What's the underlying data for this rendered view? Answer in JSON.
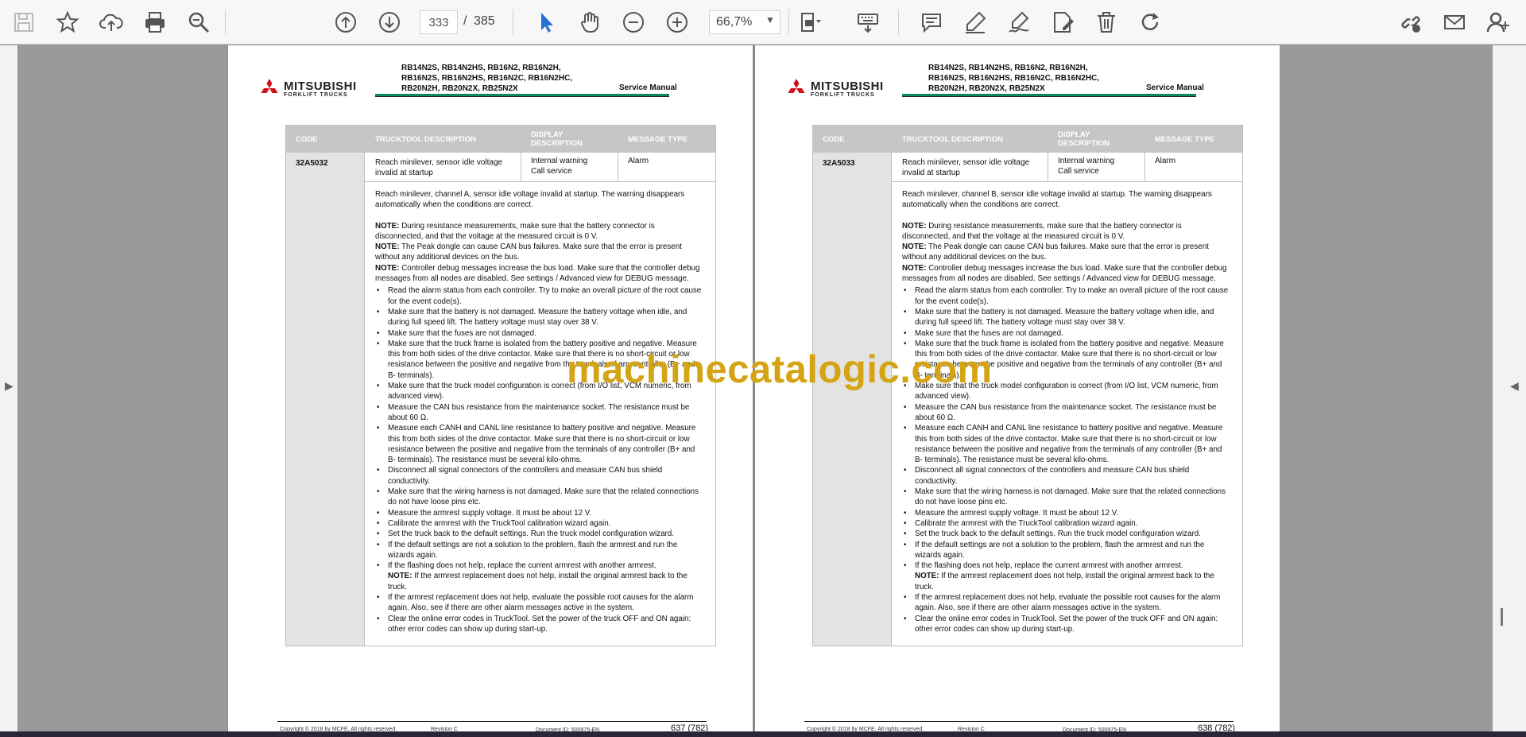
{
  "toolbar": {
    "page_current": "333",
    "page_separator": "/",
    "page_total": "385",
    "zoom": "66,7%",
    "icons": [
      "save-icon",
      "bookmark-star-icon",
      "upload-cloud-icon",
      "print-icon",
      "zoom-find-icon",
      "page-up-icon",
      "page-down-icon",
      "select-cursor-icon",
      "hand-tool-icon",
      "zoom-out-icon",
      "zoom-in-icon",
      "page-fit-icon",
      "keyboard-icon",
      "comment-icon",
      "highlight-pen-icon",
      "sign-icon",
      "edit-text-icon",
      "delete-icon",
      "redo-icon",
      "share-link-icon",
      "email-icon",
      "add-user-icon"
    ]
  },
  "colors": {
    "accent_green": "#0a8a5a",
    "header_gray": "#c6c6c6",
    "watermark": "#d4a414",
    "cursor_blue": "#2a6fd6"
  },
  "header": {
    "logo_text": "MITSUBISHI",
    "logo_subtext": "FORKLIFT TRUCKS",
    "models_line1": "RB14N2S, RB14N2HS, RB16N2, RB16N2H,",
    "models_line2": "RB16N2S, RB16N2HS, RB16N2C, RB16N2HC,",
    "models_line3": "RB20N2H, RB20N2X, RB25N2X",
    "service_manual": "Service Manual"
  },
  "table_header": {
    "code": "CODE",
    "trucktool": "TRUCKTOOL DESCRIPTION",
    "display1": "DISPLAY",
    "display2": "DESCRIPTION",
    "message": "MESSAGE TYPE"
  },
  "common": {
    "desc1": "Reach minilever, sensor idle voltage",
    "desc2": "invalid at startup",
    "disp1": "Internal warning",
    "disp2": "Call service",
    "msg": "Alarm",
    "auto": "automatically when the conditions are correct.",
    "note": "NOTE:",
    "n1a": " During resistance measurements, make sure that the battery connector is",
    "n1b": "disconnected, and that the voltage at the measured circuit is 0 V.",
    "n2a": " The Peak dongle can cause CAN bus failures. Make sure that the error is present",
    "n2b": "without any additional devices on the bus.",
    "n3a": " Controller debug messages increase the bus load. Make sure that the controller debug",
    "n3b": "messages from all nodes are disabled. See settings / Advanced view for DEBUG message.",
    "b1a": "Read the alarm status from each controller. Try to make an overall picture of the root cause",
    "b1b": "for the event code(s).",
    "b2a": "Make sure that the battery is not damaged. Measure the battery voltage when idle, and",
    "b2b": "during full speed lift. The battery voltage must stay over 38 V.",
    "b3": "Make sure that the fuses are not damaged.",
    "b4a": "Make sure that the truck frame is isolated from the battery positive and negative. Measure",
    "b4b": "this from both sides of the drive contactor. Make sure that there is no short-circuit or low",
    "b4c": "resistance between the positive and negative from the terminals of any controller (B+ and",
    "b4d": "B- terminals).",
    "b5a": "Make sure that the truck model configuration is correct (from I/O list, VCM numeric, from",
    "b5b": "advanced view).",
    "b6a": "Measure the CAN bus resistance from the maintenance socket. The resistance must be",
    "b6b": "about 60 Ω.",
    "b7a": "Measure each CANH and CANL line resistance to battery positive and negative. Measure",
    "b7b": "this from both sides of the drive contactor. Make sure that there is no short-circuit or low",
    "b7c": "resistance between the positive and negative from the terminals of any controller (B+ and",
    "b7d": "B- terminals). The resistance must be several kilo-ohms.",
    "b8a": "Disconnect all signal connectors of the controllers and measure CAN bus shield",
    "b8b": "conductivity.",
    "b9a": "Make sure that the wiring harness is not damaged. Make sure that the related connections",
    "b9b": "do not have loose pins etc.",
    "b10": "Measure the armrest supply voltage. It must be about 12 V.",
    "b11": "Calibrate the armrest with the TruckTool calibration wizard again.",
    "b12": "Set the truck back to the default settings. Run the truck model configuration wizard.",
    "b13a": "If the default settings are not a solution to the problem, flash the armrest and run the",
    "b13b": "wizards again.",
    "b14": "If the flashing does not help, replace the current armrest with another armrest.",
    "b14n": " If the armrest replacement does not help, install the original armrest back to the",
    "b14nb": "truck.",
    "b15a": "If the armrest replacement does not help, evaluate the possible root causes for the alarm",
    "b15b": "again. Also, see if there are other alarm messages active in the system.",
    "b16a": "Clear the online error codes in TruckTool. Set the power of the truck OFF and ON again:",
    "b16b": "other error codes can show up during start-up.",
    "footer_copy": "Copyright © 2018 by MCFE. All rights reserved.",
    "footer_rev": "Revision C",
    "footer_doc": "Document ID: 500975-EN"
  },
  "page_a": {
    "code": "32A5032",
    "intro": "Reach minilever, channel A, sensor idle voltage invalid at startup. The warning disappears",
    "page_num": "637 (782)"
  },
  "page_b": {
    "code": "32A5033",
    "intro": "Reach minilever, channel B, sensor idle voltage invalid at startup. The warning disappears",
    "page_num": "638 (782)"
  },
  "watermark": "machinecatalogic.com"
}
